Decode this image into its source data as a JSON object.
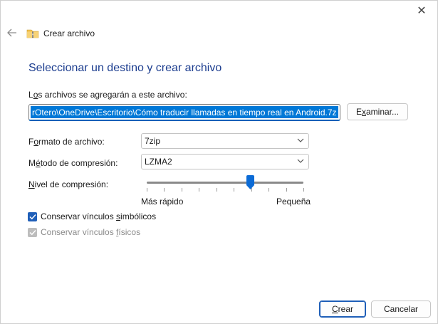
{
  "window": {
    "title": "Crear archivo",
    "close_glyph": "✕",
    "back_glyph": "←"
  },
  "heading": "Seleccionar un destino y crear archivo",
  "path": {
    "label_pre": "L",
    "label_underlined": "o",
    "label_post": "s archivos se agregarán a este archivo:",
    "value": "rOtero\\OneDrive\\Escritorio\\Cómo traducir llamadas en tiempo real en Android.7z"
  },
  "browse_button": {
    "pre": "E",
    "underlined": "x",
    "post": "aminar..."
  },
  "format": {
    "label_pre": "F",
    "label_underlined": "o",
    "label_post": "rmato de archivo:",
    "value": "7zip"
  },
  "method": {
    "label_pre": "M",
    "label_underlined": "é",
    "label_post": "todo de compresión:",
    "value": "LZMA2"
  },
  "level": {
    "label_pre": "",
    "label_underlined": "N",
    "label_post": "ivel de compresión:",
    "value_fraction": 0.66,
    "tick_count": 10,
    "min_label": "Más rápido",
    "max_label": "Pequeña"
  },
  "symlinks": {
    "label_pre": "Conservar vínculos ",
    "label_underlined": "s",
    "label_post": "imbólicos",
    "checked": true,
    "enabled": true
  },
  "hardlinks": {
    "label_pre": "Conservar vínculos ",
    "label_underlined": "f",
    "label_post": "ísicos",
    "checked": true,
    "enabled": false
  },
  "create_button": {
    "pre": "",
    "underlined": "C",
    "post": "rear"
  },
  "cancel_button": "Cancelar",
  "colors": {
    "accent": "#1f5fb8",
    "heading": "#1c3d8f",
    "selection": "#0078d7"
  }
}
